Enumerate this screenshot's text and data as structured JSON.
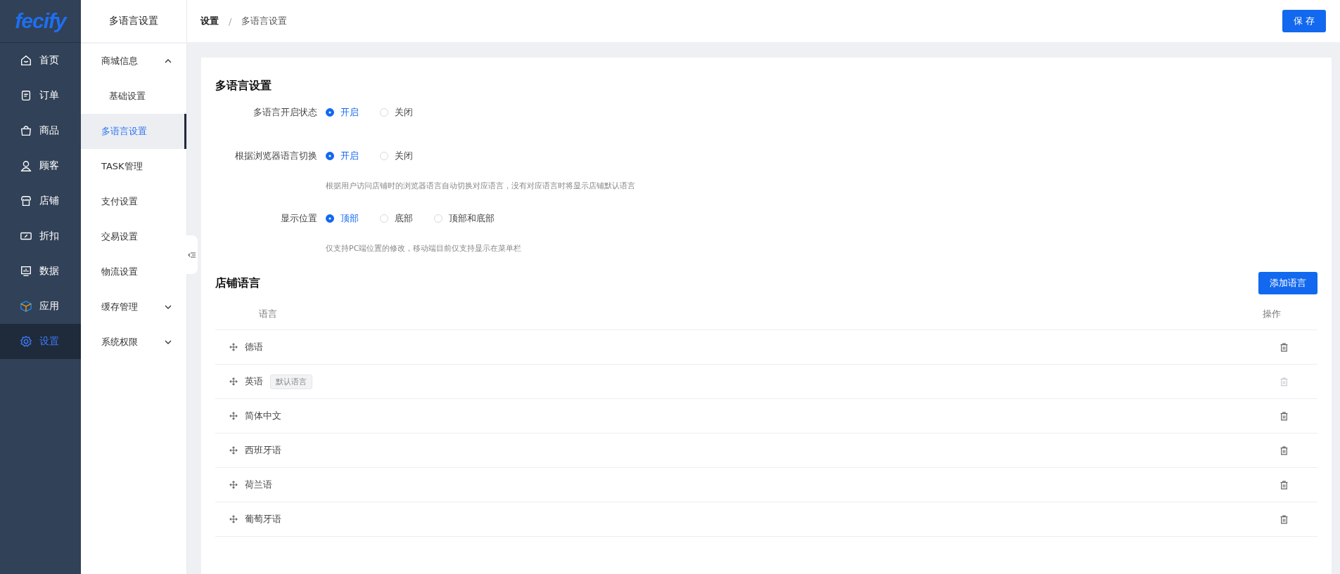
{
  "logo": "fecify",
  "nav": [
    {
      "label": "首页",
      "kind": "home",
      "selected": false
    },
    {
      "label": "订单",
      "kind": "order",
      "selected": false
    },
    {
      "label": "商品",
      "kind": "bag",
      "selected": false
    },
    {
      "label": "顾客",
      "kind": "user",
      "selected": false
    },
    {
      "label": "店铺",
      "kind": "store",
      "selected": false
    },
    {
      "label": "折扣",
      "kind": "discount",
      "selected": false
    },
    {
      "label": "数据",
      "kind": "chart",
      "selected": false
    },
    {
      "label": "应用",
      "kind": "box",
      "selected": false
    },
    {
      "label": "设置",
      "kind": "gear",
      "selected": true
    }
  ],
  "submenu": {
    "title": "多语言设置",
    "items": [
      {
        "label": "商城信息",
        "expanded": true,
        "children": [
          {
            "label": "基础设置",
            "selected": false
          }
        ]
      },
      {
        "label": "多语言设置",
        "selected": true
      },
      {
        "label": "TASK管理",
        "selected": false
      },
      {
        "label": "支付设置",
        "selected": false
      },
      {
        "label": "交易设置",
        "selected": false
      },
      {
        "label": "物流设置",
        "selected": false
      },
      {
        "label": "缓存管理",
        "expanded": false
      },
      {
        "label": "系统权限",
        "expanded": false
      }
    ]
  },
  "breadcrumb": [
    "设置",
    "多语言设置"
  ],
  "breadcrumb_separator": "/",
  "save_button": "保 存",
  "settings": {
    "title": "多语言设置",
    "fields": [
      {
        "label": "多语言开启状态",
        "options": [
          {
            "label": "开启",
            "selected": true
          },
          {
            "label": "关闭",
            "selected": false
          }
        ]
      },
      {
        "label": "根据浏览器语言切换",
        "options": [
          {
            "label": "开启",
            "selected": true
          },
          {
            "label": "关闭",
            "selected": false
          }
        ],
        "hint": "根据用户访问店铺时的浏览器语言自动切换对应语言，没有对应语言时将显示店铺默认语言"
      },
      {
        "label": "显示位置",
        "options": [
          {
            "label": "顶部",
            "selected": true
          },
          {
            "label": "底部",
            "selected": false
          },
          {
            "label": "顶部和底部",
            "selected": false
          }
        ],
        "hint": "仅支持PC端位置的修改，移动端目前仅支持显示在菜单栏"
      }
    ]
  },
  "languages": {
    "title": "店铺语言",
    "add_button": "添加语言",
    "columns": [
      "语言",
      "操作"
    ],
    "rows": [
      {
        "name": "德语",
        "delete_disabled": false
      },
      {
        "name": "英语",
        "tag": "默认语言",
        "delete_disabled": true
      },
      {
        "name": "简体中文",
        "delete_disabled": false
      },
      {
        "name": "西班牙语",
        "delete_disabled": false
      },
      {
        "name": "荷兰语",
        "delete_disabled": false
      },
      {
        "name": "葡萄牙语",
        "delete_disabled": false
      }
    ]
  }
}
